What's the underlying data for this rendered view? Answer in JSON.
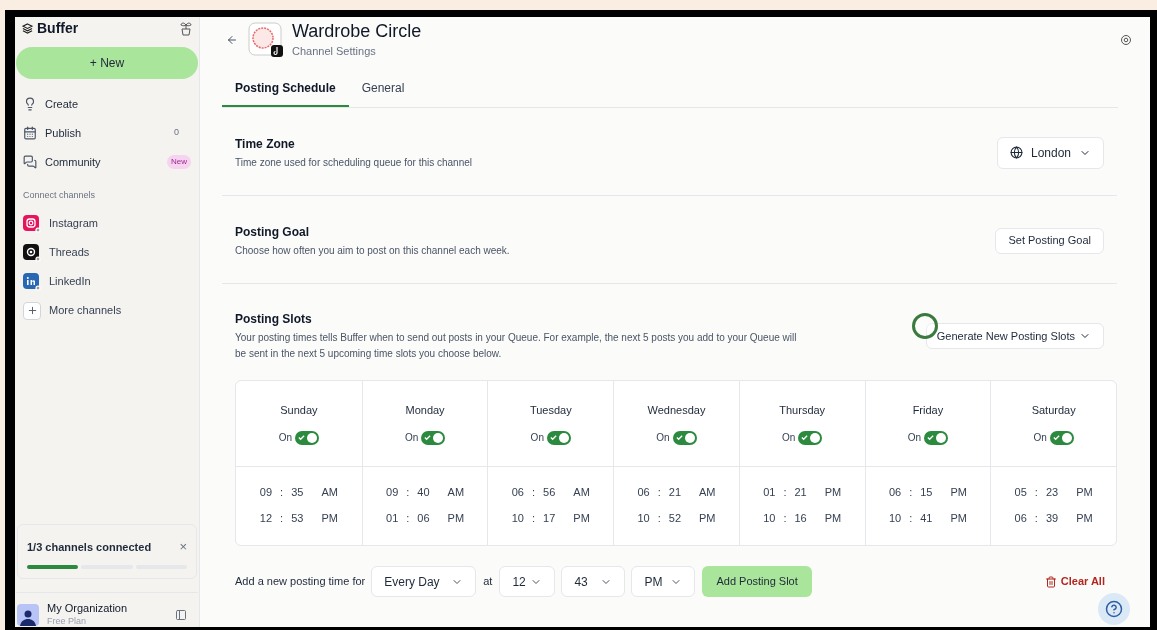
{
  "sidebar": {
    "brand": "Buffer",
    "new_button": "+ New",
    "nav": [
      {
        "kind": "create",
        "label": "Create"
      },
      {
        "kind": "publish",
        "label": "Publish",
        "count": "0"
      },
      {
        "kind": "community",
        "label": "Community",
        "badge": "New"
      }
    ],
    "section_label": "Connect channels",
    "channels": [
      {
        "kind": "instagram",
        "label": "Instagram",
        "color": "#e4145f"
      },
      {
        "kind": "threads",
        "label": "Threads",
        "color": "#111111"
      },
      {
        "kind": "linkedin",
        "label": "LinkedIn",
        "color": "#2867b2"
      },
      {
        "kind": "more",
        "label": "More channels"
      }
    ],
    "progress": {
      "label": "1/3 channels connected",
      "close": "×",
      "level": 0.333
    },
    "account": {
      "name": "My Organization",
      "plan": "Free Plan"
    }
  },
  "header": {
    "title": "Wardrobe Circle",
    "subtitle": "Channel Settings"
  },
  "tabs": [
    {
      "label": "Posting Schedule",
      "selected": true
    },
    {
      "label": "General",
      "selected": false
    }
  ],
  "sections": [
    {
      "kind": "timezone",
      "title": "Time Zone",
      "description": "Time zone used for scheduling queue for this channel",
      "action": "London"
    },
    {
      "kind": "goal",
      "title": "Posting Goal",
      "description": "Choose how often you aim to post on this channel each week.",
      "action": "Set Posting Goal"
    },
    {
      "kind": "slots",
      "title": "Posting Slots",
      "description": "Your posting times tells Buffer when to send out posts in your Queue. For example, the next 5 posts you add to your Queue will be sent in the next 5 upcoming time slots you choose below.",
      "action": "Generate New Posting Slots"
    }
  ],
  "days": [
    {
      "name": "Sunday",
      "toggle_label": "On",
      "on": true,
      "slots": [
        {
          "hour": "09",
          "colon": ":",
          "minute": "35",
          "period": "AM"
        },
        {
          "hour": "12",
          "colon": ":",
          "minute": "53",
          "period": "PM"
        }
      ]
    },
    {
      "name": "Monday",
      "toggle_label": "On",
      "on": true,
      "slots": [
        {
          "hour": "09",
          "colon": ":",
          "minute": "40",
          "period": "AM"
        },
        {
          "hour": "01",
          "colon": ":",
          "minute": "06",
          "period": "PM"
        }
      ]
    },
    {
      "name": "Tuesday",
      "toggle_label": "On",
      "on": true,
      "slots": [
        {
          "hour": "06",
          "colon": ":",
          "minute": "56",
          "period": "AM"
        },
        {
          "hour": "10",
          "colon": ":",
          "minute": "17",
          "period": "PM"
        }
      ]
    },
    {
      "name": "Wednesday",
      "toggle_label": "On",
      "on": true,
      "slots": [
        {
          "hour": "06",
          "colon": ":",
          "minute": "21",
          "period": "AM"
        },
        {
          "hour": "10",
          "colon": ":",
          "minute": "52",
          "period": "PM"
        }
      ]
    },
    {
      "name": "Thursday",
      "toggle_label": "On",
      "on": true,
      "slots": [
        {
          "hour": "01",
          "colon": ":",
          "minute": "21",
          "period": "PM"
        },
        {
          "hour": "10",
          "colon": ":",
          "minute": "16",
          "period": "PM"
        }
      ]
    },
    {
      "name": "Friday",
      "toggle_label": "On",
      "on": true,
      "slots": [
        {
          "hour": "06",
          "colon": ":",
          "minute": "15",
          "period": "PM"
        },
        {
          "hour": "10",
          "colon": ":",
          "minute": "41",
          "period": "PM"
        }
      ]
    },
    {
      "name": "Saturday",
      "toggle_label": "On",
      "on": true,
      "slots": [
        {
          "hour": "05",
          "colon": ":",
          "minute": "23",
          "period": "PM"
        },
        {
          "hour": "06",
          "colon": ":",
          "minute": "39",
          "period": "PM"
        }
      ]
    }
  ],
  "add_row": {
    "label": "Add a new posting time for",
    "frequency": "Every Day",
    "at": "at",
    "hour": "12",
    "minute": "43",
    "period": "PM",
    "add_button": "Add Posting Slot",
    "clear_button": "Clear All"
  }
}
